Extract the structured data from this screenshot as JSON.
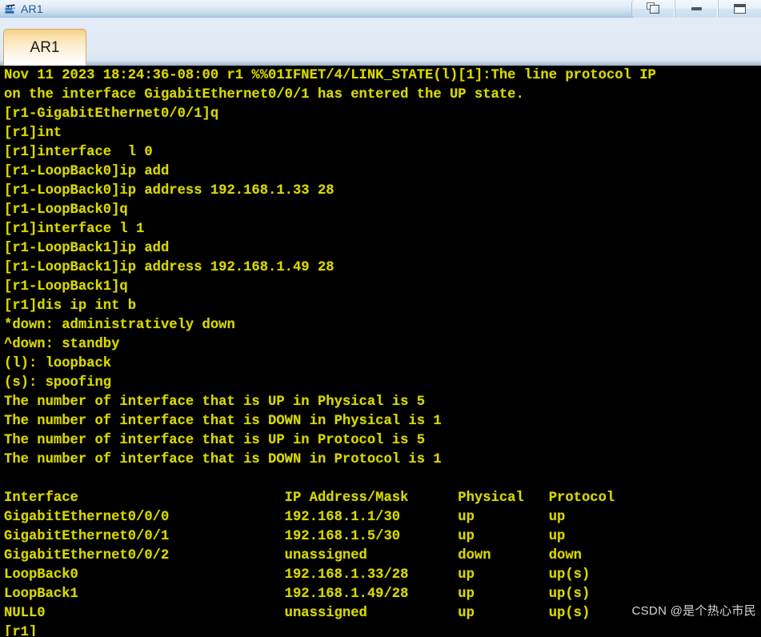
{
  "window": {
    "title": "AR1",
    "icon": "router-icon",
    "controls": [
      {
        "name": "restore-button",
        "icon": "restore-icon",
        "label": "Restore"
      },
      {
        "name": "minimize-button",
        "icon": "minimize-icon",
        "label": "Minimize"
      },
      {
        "name": "maximize-button",
        "icon": "maximize-icon",
        "label": "Maximize"
      }
    ]
  },
  "tabs": [
    {
      "label": "AR1",
      "active": true
    }
  ],
  "terminal": {
    "foreground_color": "#d8d800",
    "background_color": "#000000",
    "prompt": "[r1]",
    "lines": [
      "Nov 11 2023 18:24:36-08:00 r1 %%01IFNET/4/LINK_STATE(l)[1]:The line protocol IP",
      "on the interface GigabitEthernet0/0/1 has entered the UP state.",
      "[r1-GigabitEthernet0/0/1]q",
      "[r1]int",
      "[r1]interface  l 0",
      "[r1-LoopBack0]ip add",
      "[r1-LoopBack0]ip address 192.168.1.33 28",
      "[r1-LoopBack0]q",
      "[r1]interface l 1",
      "[r1-LoopBack1]ip add",
      "[r1-LoopBack1]ip address 192.168.1.49 28",
      "[r1-LoopBack1]q",
      "[r1]dis ip int b",
      "*down: administratively down",
      "^down: standby",
      "(l): loopback",
      "(s): spoofing",
      "The number of interface that is UP in Physical is 5",
      "The number of interface that is DOWN in Physical is 1",
      "The number of interface that is UP in Protocol is 5",
      "The number of interface that is DOWN in Protocol is 1",
      "",
      "Interface                         IP Address/Mask      Physical   Protocol",
      "GigabitEthernet0/0/0              192.168.1.1/30       up         up",
      "GigabitEthernet0/0/1              192.168.1.5/30       up         up",
      "GigabitEthernet0/0/2              unassigned           down       down",
      "LoopBack0                         192.168.1.33/28      up         up(s)",
      "LoopBack1                         192.168.1.49/28      up         up(s)",
      "NULL0                             unassigned           up         up(s)",
      "[r1]"
    ],
    "interface_table": {
      "columns": [
        "Interface",
        "IP Address/Mask",
        "Physical",
        "Protocol"
      ],
      "rows": [
        [
          "GigabitEthernet0/0/0",
          "192.168.1.1/30",
          "up",
          "up"
        ],
        [
          "GigabitEthernet0/0/1",
          "192.168.1.5/30",
          "up",
          "up"
        ],
        [
          "GigabitEthernet0/0/2",
          "unassigned",
          "down",
          "down"
        ],
        [
          "LoopBack0",
          "192.168.1.33/28",
          "up",
          "up(s)"
        ],
        [
          "LoopBack1",
          "192.168.1.49/28",
          "up",
          "up(s)"
        ],
        [
          "NULL0",
          "unassigned",
          "up",
          "up(s)"
        ]
      ]
    },
    "counters": {
      "up_physical": 5,
      "down_physical": 1,
      "up_protocol": 5,
      "down_protocol": 1
    },
    "legend": [
      "*down: administratively down",
      "^down: standby",
      "(l): loopback",
      "(s): spoofing"
    ]
  },
  "watermark": {
    "text": "CSDN @是个热心市民"
  }
}
